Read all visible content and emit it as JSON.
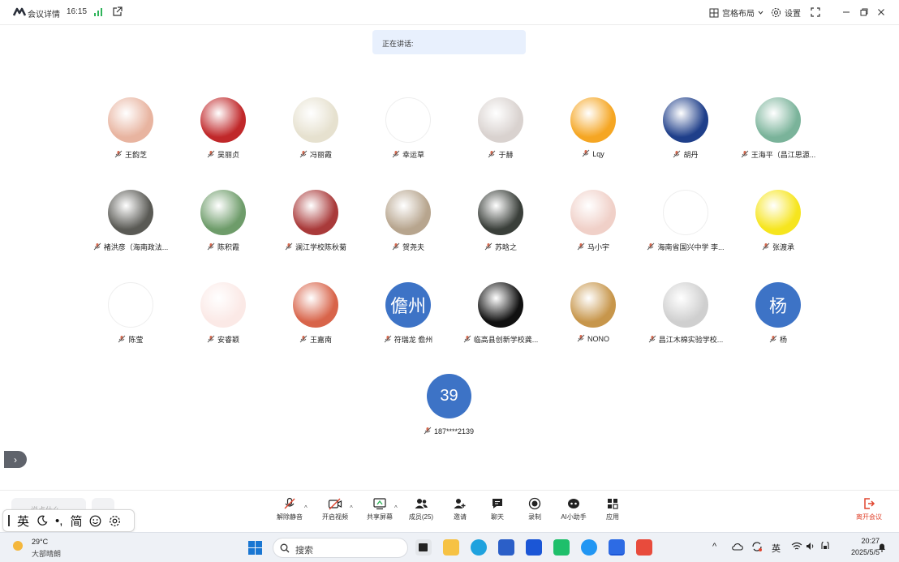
{
  "window": {
    "title": "会议详情",
    "time": "16:15",
    "layout_label": "宫格布局",
    "settings_label": "设置"
  },
  "speaking_label": "正在讲话:",
  "participants": [
    {
      "name": "王韵芝",
      "avatar_color": "#e8b4a0"
    },
    {
      "name": "吴丽贞",
      "avatar_color": "#c0282a"
    },
    {
      "name": "冯丽霞",
      "avatar_color": "#e6e1cf"
    },
    {
      "name": "幸运草",
      "avatar_color": "#ffffff"
    },
    {
      "name": "于赫",
      "avatar_color": "#d9d2cf"
    },
    {
      "name": "Lqy",
      "avatar_color": "#f5a623"
    },
    {
      "name": "胡丹",
      "avatar_color": "#1f3f8a"
    },
    {
      "name": "王海平（昌江思源...",
      "avatar_color": "#7ab39a"
    },
    {
      "name": "褚洪彦（海南政法...",
      "avatar_color": "#5a5a55"
    },
    {
      "name": "陈积霞",
      "avatar_color": "#6e9c6a"
    },
    {
      "name": "澜江学校陈秋菊",
      "avatar_color": "#a93a3a"
    },
    {
      "name": "贺尧夫",
      "avatar_color": "#b7a58e"
    },
    {
      "name": "苏晗之",
      "avatar_color": "#3a3f3a"
    },
    {
      "name": "马小宇",
      "avatar_color": "#f0d0c8"
    },
    {
      "name": "海南省国兴中学 李...",
      "avatar_color": "#ffffff"
    },
    {
      "name": "张渡承",
      "avatar_color": "#f6e51e"
    },
    {
      "name": "陈莹",
      "avatar_color": "#ffffff"
    },
    {
      "name": "安睿颖",
      "avatar_color": "#fbe9e6"
    },
    {
      "name": "王嘉南",
      "avatar_color": "#d8644a"
    },
    {
      "name": "符瑞龙 儋州",
      "avatar_color": "#3d73c6",
      "initial": "儋州"
    },
    {
      "name": "临高县创新学校龚...",
      "avatar_color": "#111111"
    },
    {
      "name": "NONO",
      "avatar_color": "#c7964b"
    },
    {
      "name": "昌江木棉实验学校...",
      "avatar_color": "#cfcfcf"
    },
    {
      "name": "杨",
      "avatar_color": "#3d73c6",
      "initial": "杨"
    }
  ],
  "extra_participant": {
    "name": "187****2139",
    "initial": "39"
  },
  "toolbar": {
    "chat_placeholder": "说点什么",
    "unmute": "解除静音",
    "start_video": "开启视频",
    "share_screen": "共享屏幕",
    "members": "成员(25)",
    "invite": "邀请",
    "chat": "聊天",
    "record": "录制",
    "ai_assistant": "AI小助手",
    "apps": "应用",
    "leave": "离开会议"
  },
  "ime": {
    "lang": "英",
    "punct": "•,",
    "simp": "简"
  },
  "taskbar": {
    "weather_temp": "29°C",
    "weather_desc": "大部晴朗",
    "search_placeholder": "搜索",
    "ime_indicator": "英",
    "clock_time": "20:27",
    "clock_date": "2025/5/5"
  }
}
